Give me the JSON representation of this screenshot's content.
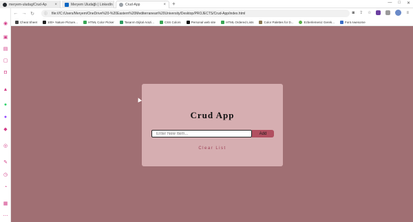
{
  "browser": {
    "tabs": [
      {
        "title": "meryem-uludag/Crud-Ap",
        "favicon_color": "#24292e",
        "active": false
      },
      {
        "title": "Meryem Uludağlı | LinkedIn",
        "favicon_color": "#0a66c2",
        "active": false
      },
      {
        "title": "Crud-App",
        "favicon_color": "#9aa0a6",
        "active": true
      }
    ],
    "new_tab": "+",
    "address": {
      "info": "ⓘ",
      "url": "file:///C:/Users/Meryem/OneDrive%20-%20Eastern%20Mediterranean%20University/Desktop/PROJECTS/Crud-App/index.html"
    },
    "bookmarks": [
      {
        "label": "Cheat Sheet",
        "color": "#444444"
      },
      {
        "label": "100+ Nature Picture...",
        "color": "#222222"
      },
      {
        "label": "HTML Color Picker",
        "color": "#3aa655"
      },
      {
        "label": "Tasarım Dijital Arazi...",
        "color": "#2e9c61"
      },
      {
        "label": "CSS Colors",
        "color": "#3aa655"
      },
      {
        "label": "Personal web site",
        "color": "#111111"
      },
      {
        "label": "HTML Ordered Lists",
        "color": "#3aa655"
      },
      {
        "label": "Color Palettes for D...",
        "color": "#8a7a55"
      },
      {
        "label": "Ezberlemeniz Gerek...",
        "color": "#5bb04a"
      },
      {
        "label": "Font Awesome",
        "color": "#3b6fc7"
      }
    ],
    "accent_color": "#d23c87"
  },
  "app": {
    "title": "Crud App",
    "input_placeholder": "Enter New Item...",
    "add_label": "Add",
    "clear_label": "Clear List",
    "colors": {
      "page_bg": "#a06f73",
      "card_bg": "#d6aeb1",
      "button_bg": "#b14f60",
      "link": "#9b3c52"
    }
  }
}
